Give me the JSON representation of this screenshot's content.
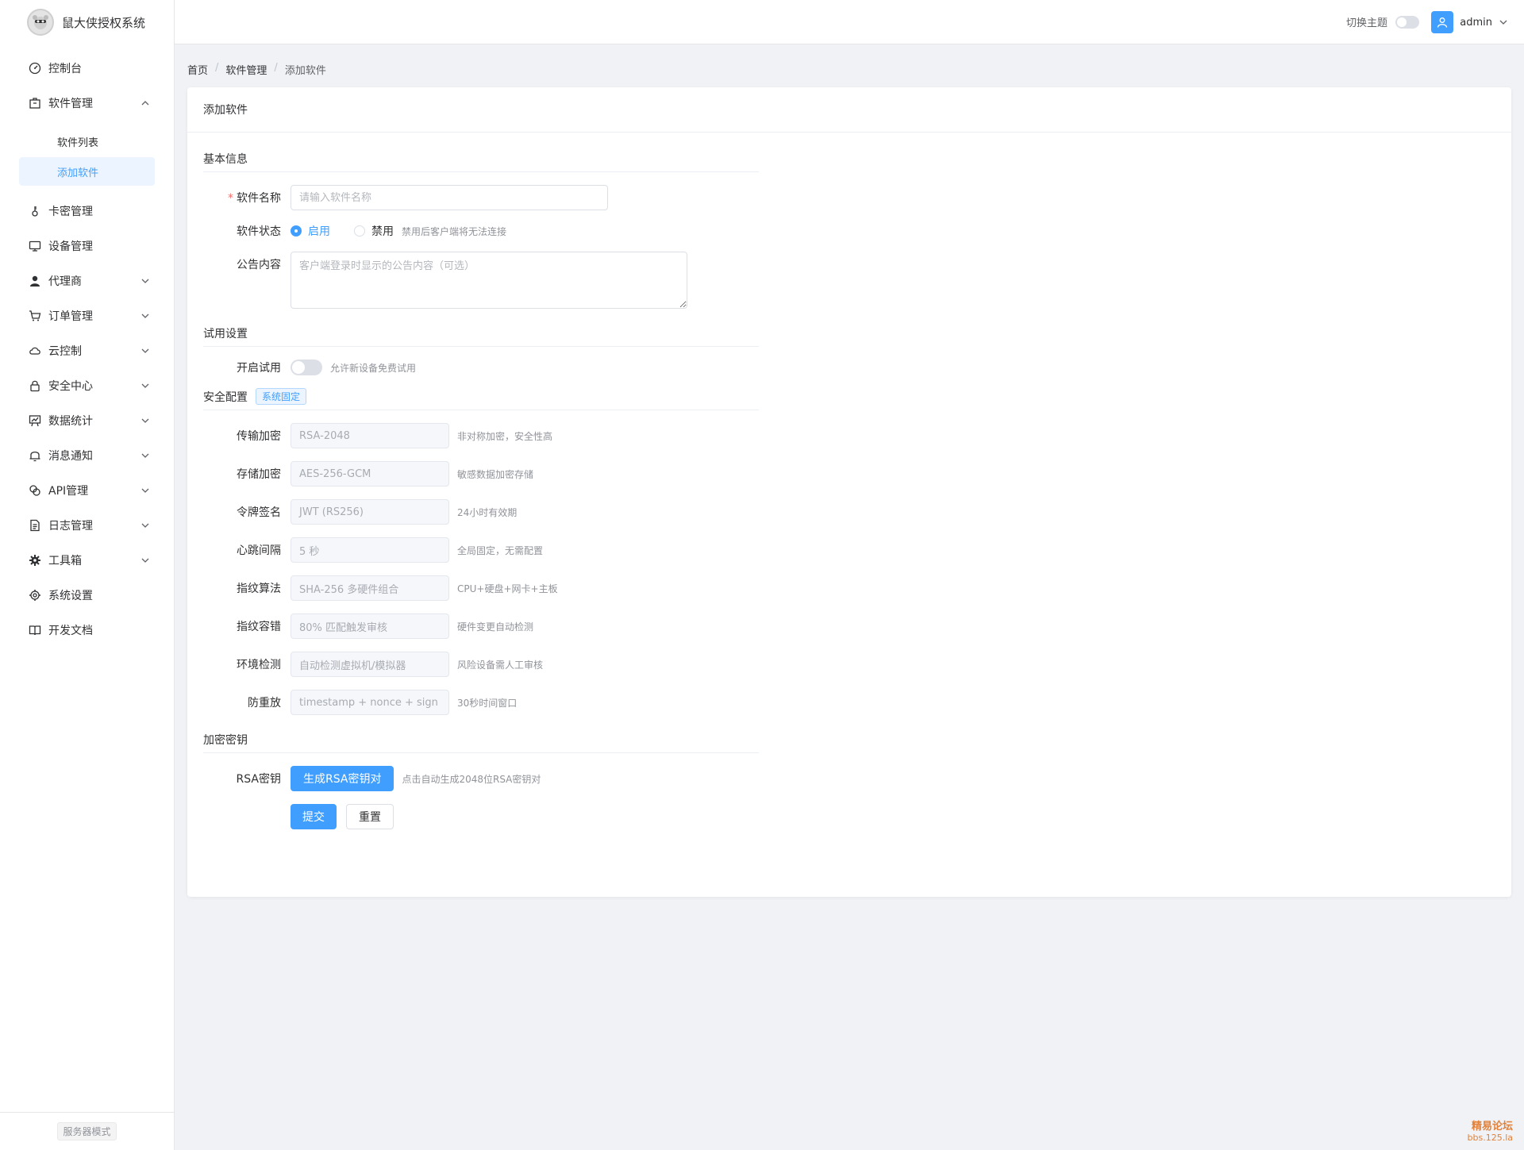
{
  "app": {
    "title": "鼠大侠授权系统"
  },
  "sidebar": {
    "menu": [
      {
        "id": "dashboard",
        "label": "控制台",
        "icon": "dashboard-icon",
        "expandable": false
      },
      {
        "id": "software",
        "label": "软件管理",
        "icon": "box-icon",
        "expandable": true,
        "expanded": true,
        "children": [
          {
            "label": "软件列表",
            "active": false
          },
          {
            "label": "添加软件",
            "active": true
          }
        ]
      },
      {
        "id": "cards",
        "label": "卡密管理",
        "icon": "key-icon",
        "expandable": false
      },
      {
        "id": "devices",
        "label": "设备管理",
        "icon": "monitor-icon",
        "expandable": false
      },
      {
        "id": "agents",
        "label": "代理商",
        "icon": "user-icon",
        "expandable": true
      },
      {
        "id": "orders",
        "label": "订单管理",
        "icon": "cart-icon",
        "expandable": true
      },
      {
        "id": "cloud",
        "label": "云控制",
        "icon": "cloud-icon",
        "expandable": true
      },
      {
        "id": "security",
        "label": "安全中心",
        "icon": "lock-icon",
        "expandable": true
      },
      {
        "id": "stats",
        "label": "数据统计",
        "icon": "chart-icon",
        "expandable": true
      },
      {
        "id": "notify",
        "label": "消息通知",
        "icon": "bell-icon",
        "expandable": true
      },
      {
        "id": "api",
        "label": "API管理",
        "icon": "link-icon",
        "expandable": true
      },
      {
        "id": "logs",
        "label": "日志管理",
        "icon": "document-icon",
        "expandable": true
      },
      {
        "id": "tools",
        "label": "工具箱",
        "icon": "tools-icon",
        "expandable": true
      },
      {
        "id": "settings",
        "label": "系统设置",
        "icon": "gear-icon",
        "expandable": false
      },
      {
        "id": "docs",
        "label": "开发文档",
        "icon": "book-icon",
        "expandable": false
      }
    ],
    "footer_badge": "服务器模式"
  },
  "header": {
    "theme_label": "切换主题",
    "username": "admin"
  },
  "breadcrumb": [
    "首页",
    "软件管理",
    "添加软件"
  ],
  "card": {
    "title": "添加软件",
    "sections": {
      "basic": "基本信息",
      "trial": "试用设置",
      "security": "安全配置",
      "security_tag": "系统固定",
      "keys": "加密密钥"
    },
    "fields": {
      "name_label": "软件名称",
      "name_placeholder": "请输入软件名称",
      "status_label": "软件状态",
      "status_on": "启用",
      "status_off": "禁用",
      "status_hint": "禁用后客户端将无法连接",
      "notice_label": "公告内容",
      "notice_placeholder": "客户端登录时显示的公告内容（可选）",
      "trial_label": "开启试用",
      "trial_hint": "允许新设备免费试用",
      "rsa_label": "RSA密钥",
      "rsa_button": "生成RSA密钥对",
      "rsa_hint": "点击自动生成2048位RSA密钥对"
    },
    "security_rows": [
      {
        "label": "传输加密",
        "value": "RSA-2048",
        "hint": "非对称加密，安全性高"
      },
      {
        "label": "存储加密",
        "value": "AES-256-GCM",
        "hint": "敏感数据加密存储"
      },
      {
        "label": "令牌签名",
        "value": "JWT (RS256)",
        "hint": "24小时有效期"
      },
      {
        "label": "心跳间隔",
        "value": "5 秒",
        "hint": "全局固定，无需配置"
      },
      {
        "label": "指纹算法",
        "value": "SHA-256 多硬件组合",
        "hint": "CPU+硬盘+网卡+主板"
      },
      {
        "label": "指纹容错",
        "value": "80% 匹配触发审核",
        "hint": "硬件变更自动检测"
      },
      {
        "label": "环境检测",
        "value": "自动检测虚拟机/模拟器",
        "hint": "风险设备需人工审核"
      },
      {
        "label": "防重放",
        "value": "timestamp + nonce + sign",
        "hint": "30秒时间窗口"
      }
    ],
    "buttons": {
      "submit": "提交",
      "reset": "重置"
    }
  },
  "watermark": {
    "line1": "精易论坛",
    "line2": "bbs.125.la"
  },
  "colors": {
    "primary": "#409eff",
    "active_bg": "#ecf5ff",
    "required": "#f56c6c"
  }
}
